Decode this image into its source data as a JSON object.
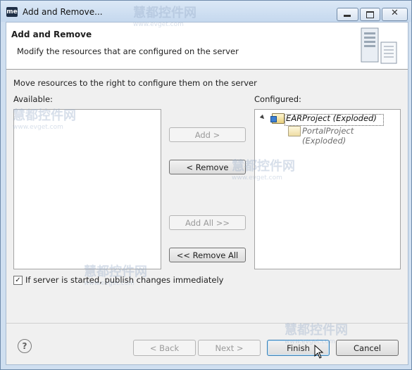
{
  "window": {
    "title": "Add and Remove...",
    "app_icon_text": "me"
  },
  "header": {
    "title": "Add and Remove",
    "description": "Modify the resources that are configured on the server"
  },
  "instruction": "Move resources to the right to configure them on the server",
  "available": {
    "label": "Available:",
    "items": []
  },
  "configured": {
    "label": "Configured:",
    "items": [
      {
        "label": "EARProject (Exploded)",
        "expanded": true,
        "selected": true
      },
      {
        "label": "PortalProject (Exploded)",
        "child": true
      }
    ]
  },
  "buttons": {
    "add": "Add >",
    "remove": "< Remove",
    "add_all": "Add All >>",
    "remove_all": "<< Remove All"
  },
  "publish_checkbox": {
    "label": "If server is started, publish changes immediately",
    "checked": true
  },
  "footer": {
    "help": "?",
    "back": "< Back",
    "next": "Next >",
    "finish": "Finish",
    "cancel": "Cancel"
  },
  "watermark": {
    "text": "慧都控件网",
    "url": "www.evget.com"
  }
}
